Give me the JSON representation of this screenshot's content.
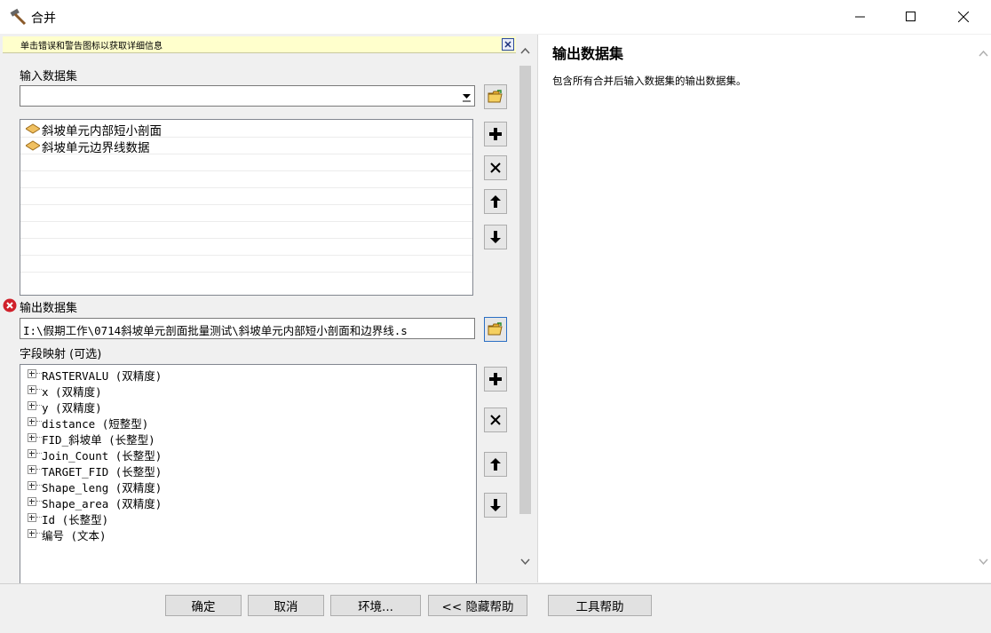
{
  "window": {
    "title": "合并",
    "controls": [
      "minimize-icon",
      "maximize-icon",
      "close-icon"
    ]
  },
  "message_bar": {
    "text": "单击错误和警告图标以获取详细信息"
  },
  "input_datasets": {
    "label": "输入数据集",
    "combo_value": "",
    "items": [
      {
        "label": "斜坡单元内部短小剖面",
        "icon": "feature-layer-icon"
      },
      {
        "label": "斜坡单元边界线数据",
        "icon": "feature-layer-icon"
      }
    ]
  },
  "output_dataset": {
    "label": "输出数据集",
    "value": "I:\\假期工作\\0714斜坡单元剖面批量测试\\斜坡单元内部短小剖面和边界线.s",
    "status_icon": "error-icon"
  },
  "field_mapping": {
    "label": "字段映射 (可选)",
    "fields": [
      "RASTERVALU (双精度)",
      "x (双精度)",
      "y (双精度)",
      "distance (短整型)",
      "FID_斜坡单 (长整型)",
      "Join_Count (长整型)",
      "TARGET_FID (长整型)",
      "Shape_leng (双精度)",
      "Shape_area (双精度)",
      "Id (长整型)",
      "编号 (文本)"
    ]
  },
  "help_panel": {
    "title": "输出数据集",
    "description": "包含所有合并后输入数据集的输出数据集。"
  },
  "buttons": {
    "ok": "确定",
    "cancel": "取消",
    "environments": "环境...",
    "hide_help": "<< 隐藏帮助",
    "tool_help": "工具帮助"
  }
}
